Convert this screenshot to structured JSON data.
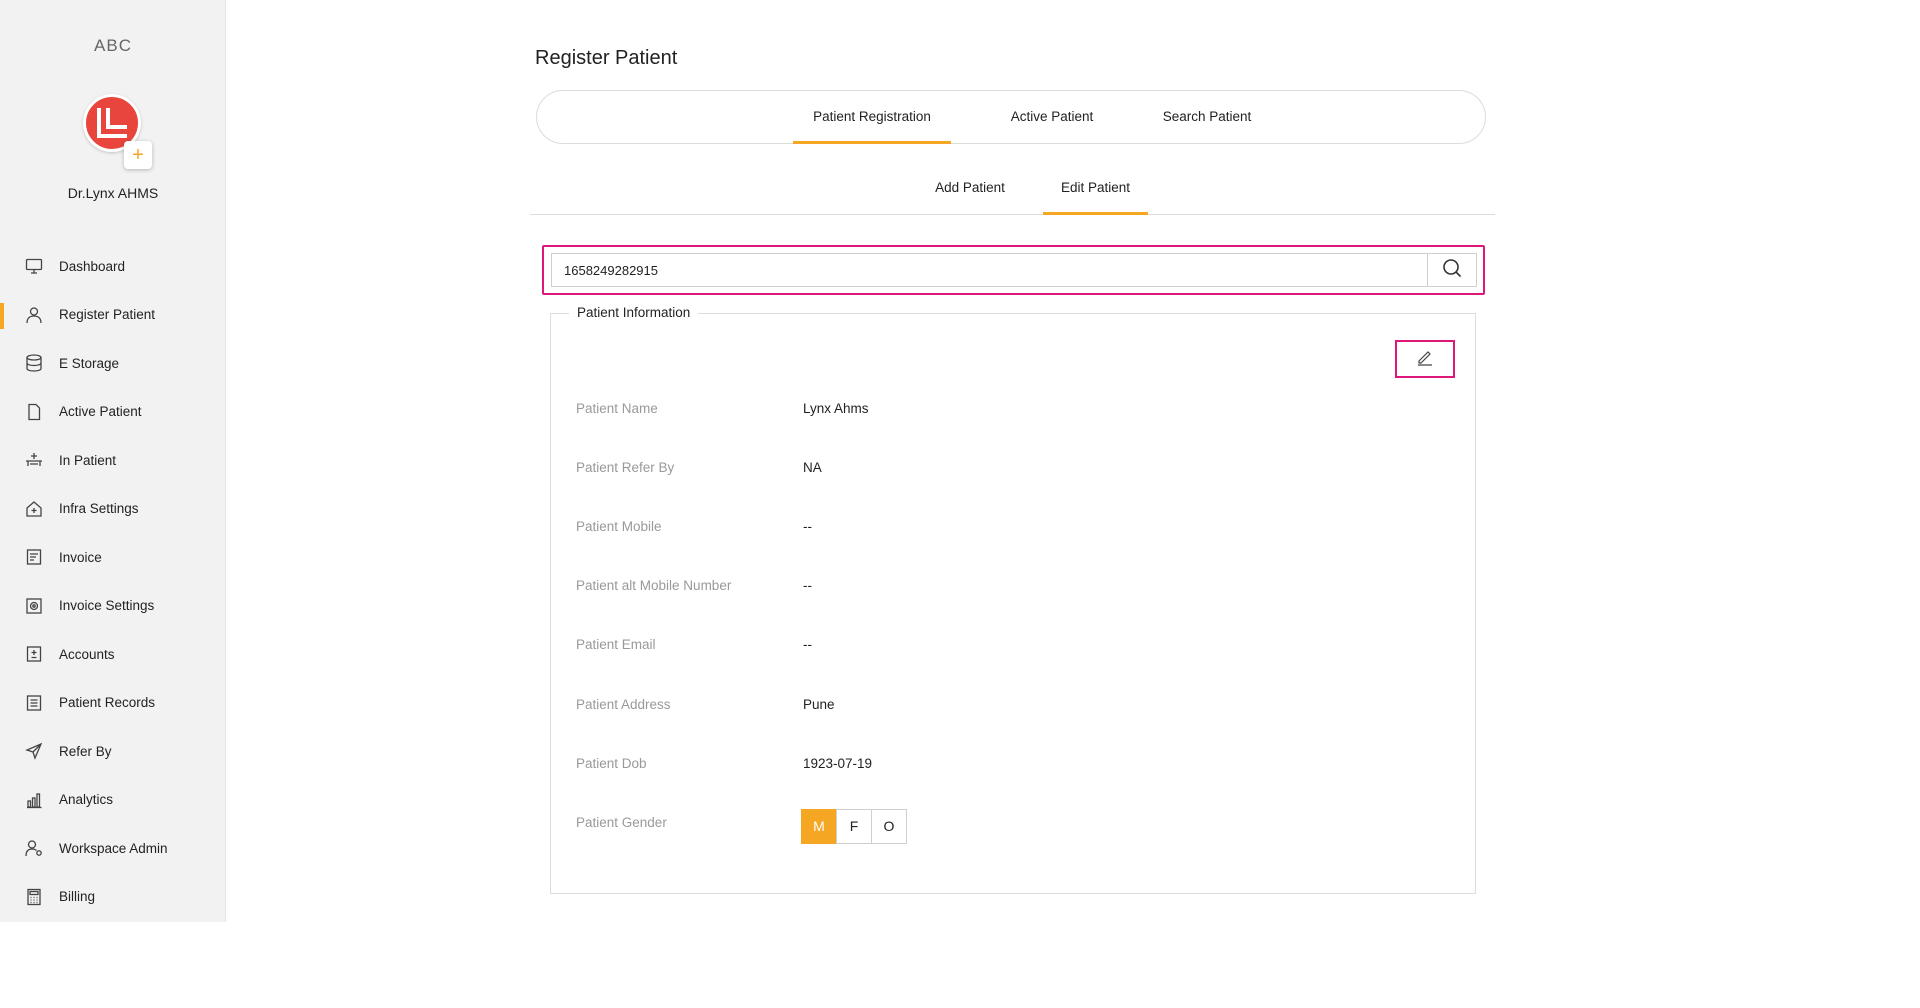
{
  "sidebar": {
    "brand": "ABC",
    "org_name": "Dr.Lynx AHMS",
    "add_symbol": "+",
    "items": [
      {
        "label": "Dashboard",
        "icon": "monitor-icon"
      },
      {
        "label": "Register Patient",
        "icon": "user-icon",
        "active": true
      },
      {
        "label": "E Storage",
        "icon": "database-icon"
      },
      {
        "label": "Active Patient",
        "icon": "file-icon"
      },
      {
        "label": "In Patient",
        "icon": "bed-icon"
      },
      {
        "label": "Infra Settings",
        "icon": "home-plus-icon"
      },
      {
        "label": "Invoice",
        "icon": "invoice-icon"
      },
      {
        "label": "Invoice Settings",
        "icon": "invoice-settings-icon"
      },
      {
        "label": "Accounts",
        "icon": "accounts-icon"
      },
      {
        "label": "Patient Records",
        "icon": "records-icon"
      },
      {
        "label": "Refer By",
        "icon": "send-icon"
      },
      {
        "label": "Analytics",
        "icon": "bar-chart-icon"
      },
      {
        "label": "Workspace Admin",
        "icon": "admin-icon"
      },
      {
        "label": "Billing",
        "icon": "calculator-icon"
      }
    ]
  },
  "main": {
    "title": "Register Patient",
    "top_tabs": [
      "Patient Registration",
      "Active Patient",
      "Search Patient"
    ],
    "sub_tabs": [
      "Add Patient",
      "Edit Patient"
    ],
    "search": {
      "value": "1658249282915"
    },
    "info": {
      "legend": "Patient Information",
      "fields": [
        {
          "label": "Patient Name",
          "value": "Lynx Ahms"
        },
        {
          "label": "Patient Refer By",
          "value": "NA"
        },
        {
          "label": "Patient Mobile",
          "value": "--"
        },
        {
          "label": "Patient alt Mobile Number",
          "value": "--"
        },
        {
          "label": "Patient Email",
          "value": "--"
        },
        {
          "label": "Patient Address",
          "value": "Pune"
        },
        {
          "label": "Patient Dob",
          "value": "1923-07-19"
        },
        {
          "label": "Patient Gender",
          "value": ""
        }
      ],
      "gender_options": [
        "M",
        "F",
        "O"
      ],
      "gender_selected": "M"
    }
  },
  "colors": {
    "accent": "#f5a623",
    "highlight": "#e0177a",
    "logo": "#e8453c"
  }
}
